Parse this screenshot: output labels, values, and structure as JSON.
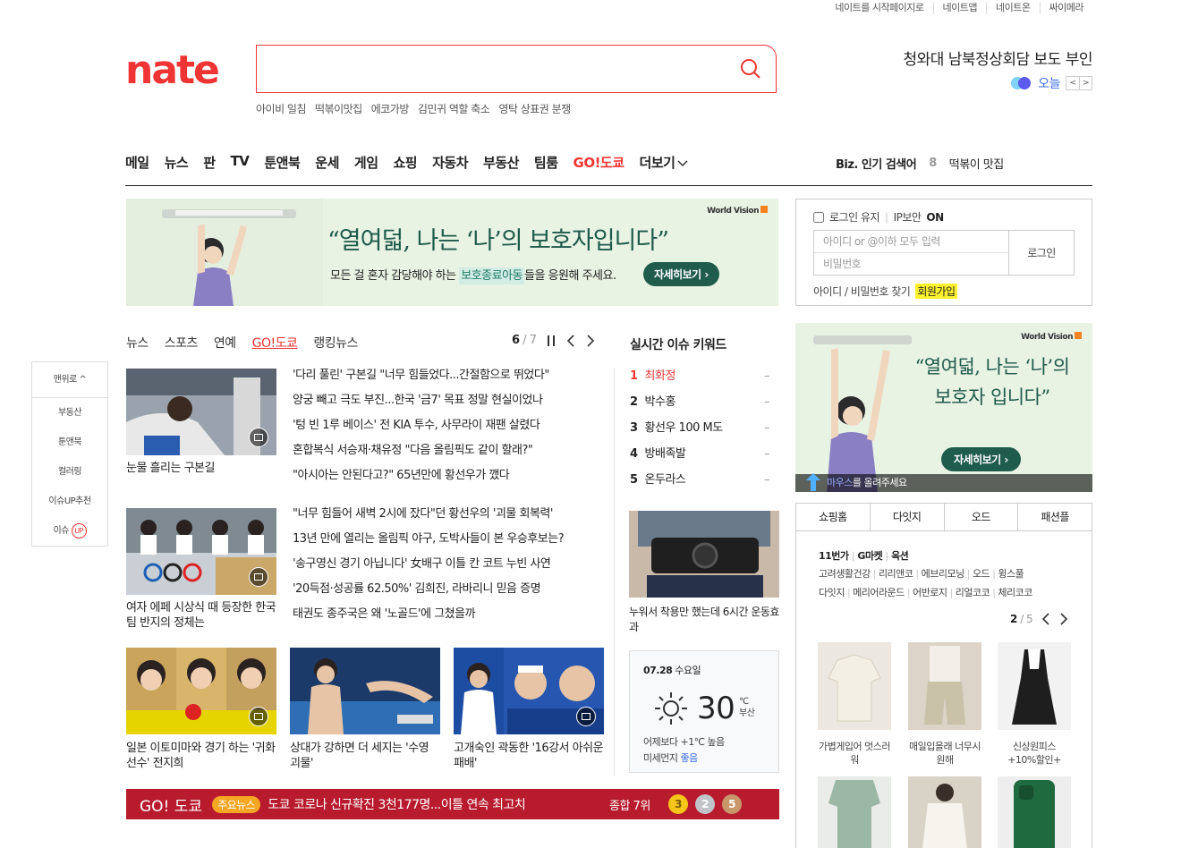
{
  "util_links": [
    "네이트를 시작페이지로",
    "네이트앱",
    "네이트온",
    "싸이메라"
  ],
  "logo": "nate",
  "search": {
    "value": "",
    "placeholder": ""
  },
  "search_keywords": [
    "아이비 일침",
    "떡볶이맛집",
    "에코가방",
    "김민귀 역할 축소",
    "영탁 상표권 분쟁"
  ],
  "headline": "청와대 남북정상회담 보도 부인",
  "today_label": "오늘",
  "gnb": [
    "메일",
    "뉴스",
    "판",
    "TV",
    "툰앤북",
    "운세",
    "게임",
    "쇼핑",
    "자동차",
    "부동산",
    "팀룸",
    "GO!도쿄",
    "더보기"
  ],
  "biz": {
    "label": "Biz. 인기 검색어",
    "rank": "8",
    "keyword": "떡볶이 맛집"
  },
  "banner1": {
    "brand": "World Vision",
    "title": "“열여덟, 나는 ‘나’의 보호자입니다”",
    "sub_pre": "모든 걸 혼자 감당해야 하는 ",
    "sub_em": "보호종료아동",
    "sub_post": "들을 응원해 주세요.",
    "button": "자세히보기 ›"
  },
  "login": {
    "keep": "로그인 유지",
    "ip": "IP보안",
    "ip_state": "ON",
    "id_placeholder": "아이디 or @이하 모두 입력",
    "pw_placeholder": "비밀번호",
    "button": "로그인",
    "find": "아이디 / 비밀번호 찾기",
    "join": "회원가입"
  },
  "news_tabs": [
    "뉴스",
    "스포츠",
    "연예",
    "GO!도쿄",
    "랭킹뉴스"
  ],
  "news_pager": {
    "current": "6",
    "total": "/ 7"
  },
  "photo1_caption": "눈물 흘리는 구본길",
  "list1": [
    "'다리 풀린' 구본길 \"너무 힘들었다...간절함으로 뛰었다\"",
    "양궁 빼고 극도 부진...한국 '금7' 목표 정말 현실이었나",
    "'텅 빈 1루 베이스' 전 KIA 투수, 사무라이 재팬 살렸다",
    "혼합복식 서승재·채유정 \"다음 올림픽도 같이 할래?\"",
    "\"아시아는 안된다고?\" 65년만에 황선우가 깼다"
  ],
  "photo2_caption": "여자 에페 시상식 때 등장한 한국팀 반지의 정체는",
  "list2": [
    "\"너무 힘들어 새벽 2시에 잤다\"던 황선우의 '괴물 회복력'",
    "13년 만에 열리는 올림픽 야구, 도박사들이 본 우승후보는?",
    "'송구영신 경기 아닙니다' 女배구 이틀 칸 코트 누빈 사연",
    "'20득점·성공률 62.50%' 김희진, 라바리니 믿음 증명",
    "태권도 종주국은 왜 '노골드'에 그쳤을까"
  ],
  "photo3_caption": "일본 이토미마와 경기 하는 '귀화 선수' 전지희",
  "photo4_caption": "상대가 강하면 더 세지는 '수영 괴물'",
  "photo5_caption": "고개숙인 곽동한 '16강서 아쉬운 패배'",
  "issue": {
    "title": "실시간 이슈 키워드",
    "items": [
      {
        "rank": "1",
        "word": "최화정",
        "delta": "–"
      },
      {
        "rank": "2",
        "word": "박수홍",
        "delta": "–"
      },
      {
        "rank": "3",
        "word": "황선우 100 M도",
        "delta": "–"
      },
      {
        "rank": "4",
        "word": "방배족발",
        "delta": "–"
      },
      {
        "rank": "5",
        "word": "온두라스",
        "delta": "–"
      }
    ]
  },
  "belt_caption": "누워서 착용만 했는데 6시간 운동효과",
  "weather": {
    "date": "07.28",
    "day": "수요일",
    "temp": "30",
    "unit": "℃",
    "region": "부산",
    "compare": "어제보다 +1℃ 높음",
    "dust_label": "미세먼지",
    "dust_value": "좋음"
  },
  "gobar": {
    "logo": "GO! 도쿄",
    "tag": "주요뉴스",
    "msg": "도쿄 코로나 신규확진 3천177명...이틀 연속 최고치",
    "rank": "종합 7위",
    "gold": "3",
    "silver": "2",
    "bronze": "5"
  },
  "banner2": {
    "brand": "World Vision",
    "title": "“열여덟, 나는 ‘나’의 보호자 입니다”",
    "button": "자세히보기 ›",
    "mouse_pre": "마우스",
    "mouse_post": "를 올려주세요"
  },
  "shop": {
    "tabs": [
      "쇼핑홈",
      "다잇지",
      "오드",
      "패션플"
    ],
    "mall_row1": [
      "11번가",
      "G마켓",
      "옥션"
    ],
    "mall_row2": [
      "고려생활건강",
      "리리앤코",
      "에브리모닝",
      "오드",
      "윙스풀"
    ],
    "mall_row3": [
      "다잇지",
      "메리어라운드",
      "어반로지",
      "리얼코코",
      "체리코코"
    ],
    "pager": {
      "current": "2",
      "total": "/ 5"
    },
    "items": [
      {
        "name": "가볍게입어 멋스러워"
      },
      {
        "name": "매일입을래 너무시원해"
      },
      {
        "name": "신상원피스 +10%할인+"
      }
    ]
  },
  "quick": {
    "top": "맨위로 ^",
    "items": [
      "부동산",
      "툰앤북",
      "컬러링",
      "이슈UP추천"
    ],
    "issue": "이슈",
    "up": "UP"
  },
  "colors": {
    "brand_red": "#ef3534",
    "go_red": "#b91b2e",
    "worldvision_green": "#1f5c4c"
  }
}
